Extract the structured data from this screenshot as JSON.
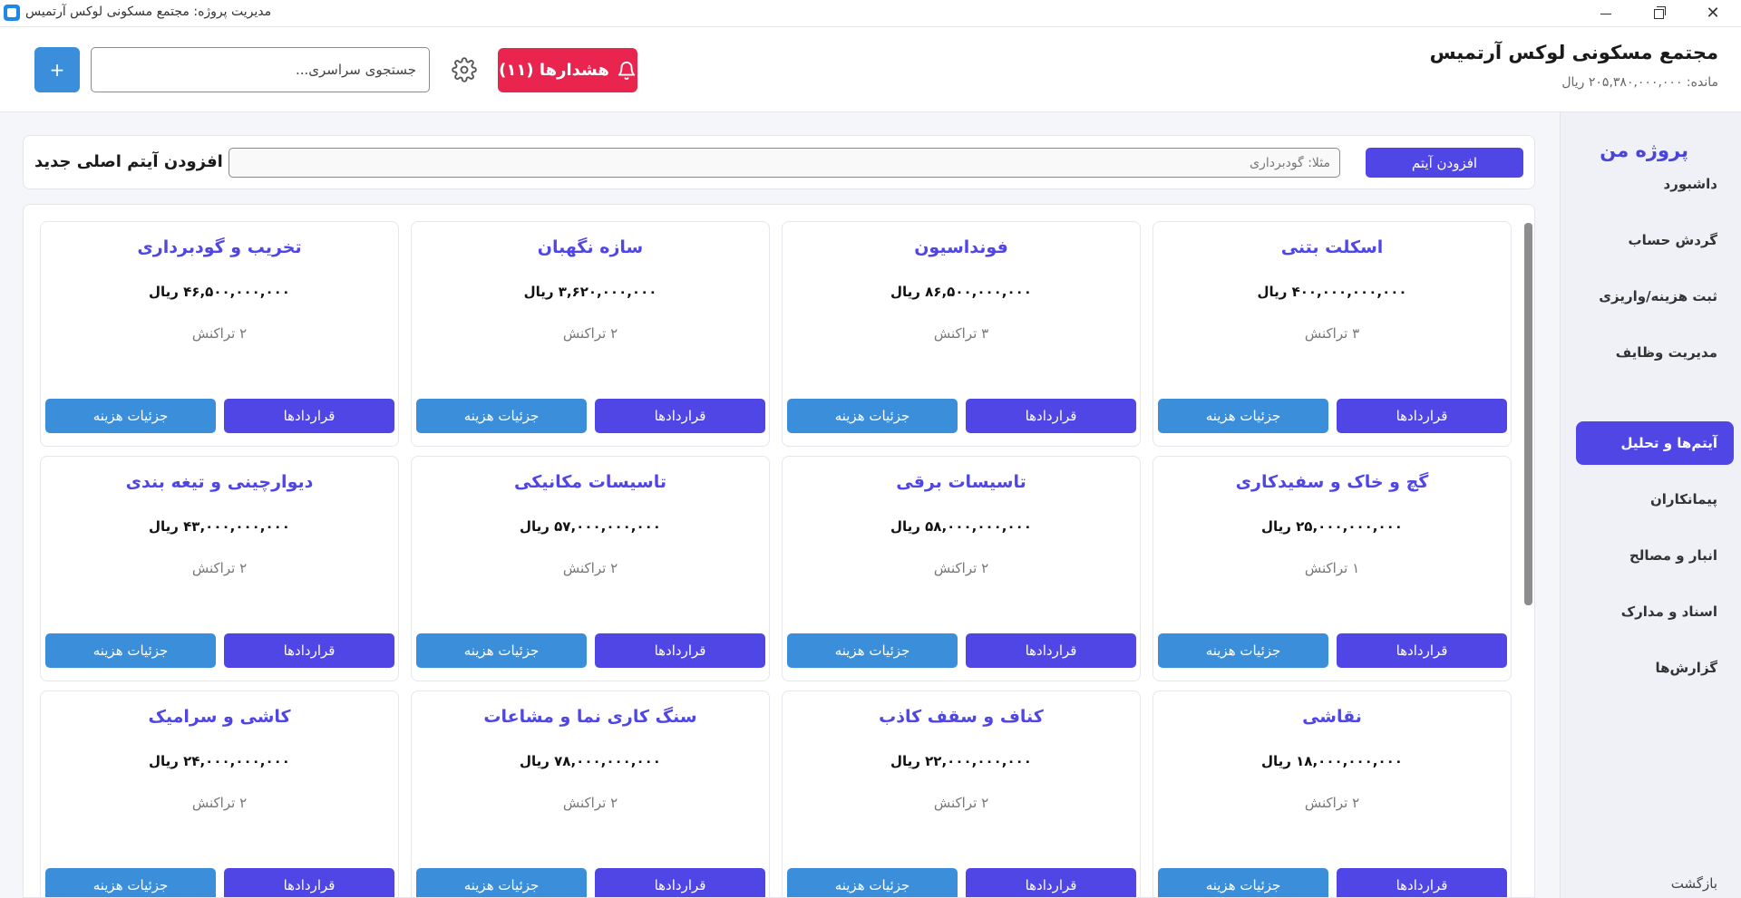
{
  "window": {
    "title": "مدیریت پروژه: مجتمع مسکونی لوکس آرتمیس"
  },
  "header": {
    "project_title": "مجتمع مسکونی لوکس آرتمیس",
    "balance": "مانده: ۲۰۵,۳۸۰,۰۰۰,۰۰۰ ریال",
    "alerts_label": "هشدارها (۱۱)",
    "search_placeholder": "جستجوی سراسری...",
    "add_label": "+"
  },
  "sidebar": {
    "brand": "پروژه من",
    "items": [
      {
        "label": "داشبورد",
        "active": false
      },
      {
        "label": "گردش حساب",
        "active": false
      },
      {
        "label": "ثبت هزینه/واریزی",
        "active": false
      },
      {
        "label": "مدیریت وظایف",
        "active": false
      },
      {
        "label": "آیتم‌ها و تحلیل",
        "active": true
      },
      {
        "label": "پیمانکاران",
        "active": false
      },
      {
        "label": "انبار و مصالح",
        "active": false
      },
      {
        "label": "اسناد و مدارک",
        "active": false
      },
      {
        "label": "گزارش‌ها",
        "active": false
      }
    ],
    "back": "بازگشت"
  },
  "add_row": {
    "title": "افزودن آیتم اصلی جدید",
    "input_placeholder": "مثلا: گودبرداری",
    "button": "افزودن آیتم"
  },
  "card_buttons": {
    "contracts": "قراردادها",
    "cost_details": "جزئیات هزینه"
  },
  "cards": [
    {
      "name": "اسکلت بتنی",
      "amount": "۴۰۰,۰۰۰,۰۰۰,۰۰۰ ریال",
      "transactions": "۳ تراکنش"
    },
    {
      "name": "فونداسیون",
      "amount": "۸۶,۵۰۰,۰۰۰,۰۰۰ ریال",
      "transactions": "۳ تراکنش"
    },
    {
      "name": "سازه نگهبان",
      "amount": "۳,۶۲۰,۰۰۰,۰۰۰ ریال",
      "transactions": "۲ تراکنش"
    },
    {
      "name": "تخریب و گودبرداری",
      "amount": "۴۶,۵۰۰,۰۰۰,۰۰۰ ریال",
      "transactions": "۲ تراکنش"
    },
    {
      "name": "گچ و خاک و سفیدکاری",
      "amount": "۲۵,۰۰۰,۰۰۰,۰۰۰ ریال",
      "transactions": "۱ تراکنش"
    },
    {
      "name": "تاسیسات برقی",
      "amount": "۵۸,۰۰۰,۰۰۰,۰۰۰ ریال",
      "transactions": "۲ تراکنش"
    },
    {
      "name": "تاسیسات مکانیکی",
      "amount": "۵۷,۰۰۰,۰۰۰,۰۰۰ ریال",
      "transactions": "۲ تراکنش"
    },
    {
      "name": "دیوارچینی و تیغه بندی",
      "amount": "۴۳,۰۰۰,۰۰۰,۰۰۰ ریال",
      "transactions": "۲ تراکنش"
    },
    {
      "name": "نقاشی",
      "amount": "۱۸,۰۰۰,۰۰۰,۰۰۰ ریال",
      "transactions": "۲ تراکنش"
    },
    {
      "name": "کناف و سقف کاذب",
      "amount": "۲۲,۰۰۰,۰۰۰,۰۰۰ ریال",
      "transactions": "۲ تراکنش"
    },
    {
      "name": "سنگ کاری نما و مشاعات",
      "amount": "۷۸,۰۰۰,۰۰۰,۰۰۰ ریال",
      "transactions": "۲ تراکنش"
    },
    {
      "name": "کاشی و سرامیک",
      "amount": "۲۴,۰۰۰,۰۰۰,۰۰۰ ریال",
      "transactions": "۲ تراکنش"
    }
  ],
  "colors": {
    "accent": "#4f46e5",
    "secondary": "#3b8ed9",
    "alert": "#e8244f"
  }
}
